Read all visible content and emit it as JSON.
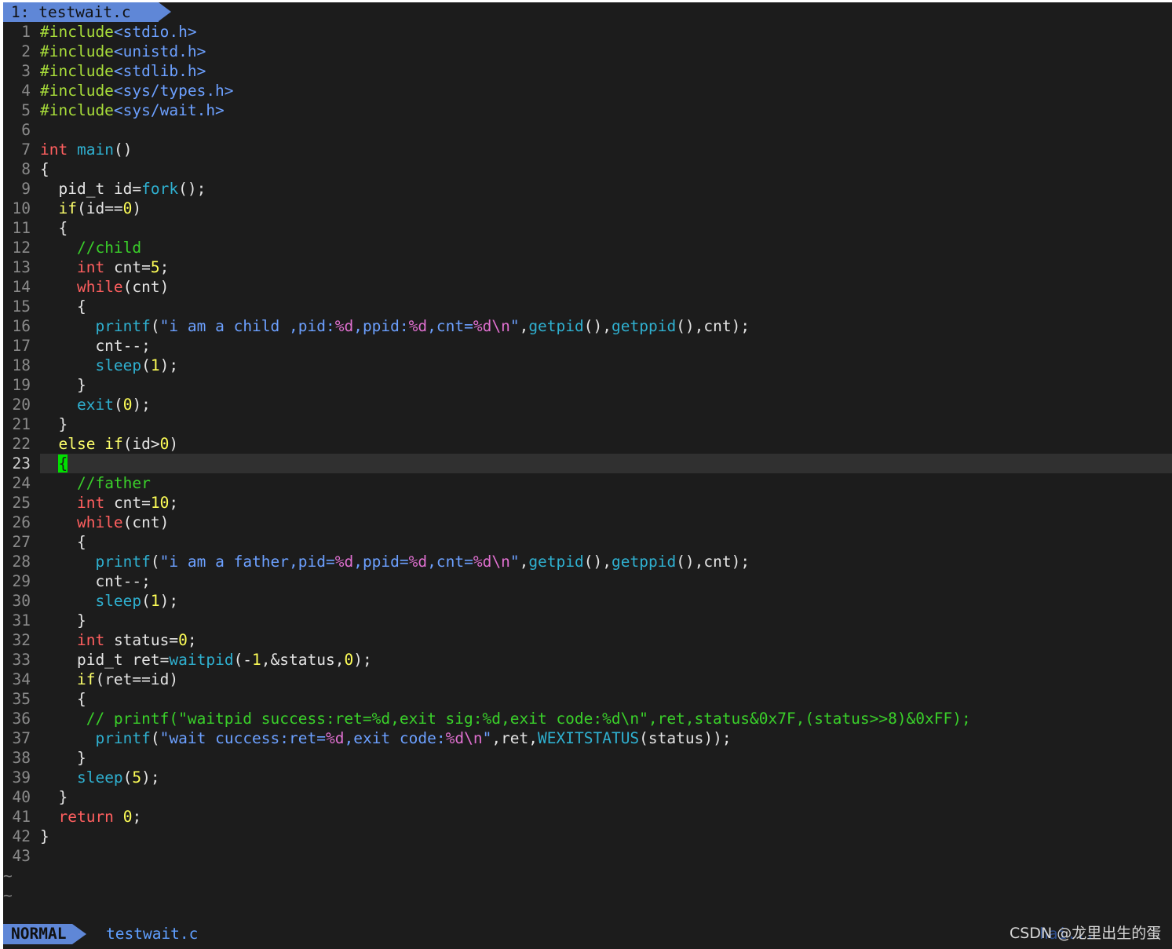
{
  "tabline": {
    "active_tab": "1: testwait.c"
  },
  "editor": {
    "lines": [
      {
        "n": "1",
        "segs": [
          {
            "t": "#include",
            "c": "pp"
          },
          {
            "t": "<stdio.h>",
            "c": "str"
          }
        ]
      },
      {
        "n": "2",
        "segs": [
          {
            "t": "#include",
            "c": "pp"
          },
          {
            "t": "<unistd.h>",
            "c": "str"
          }
        ]
      },
      {
        "n": "3",
        "segs": [
          {
            "t": "#include",
            "c": "pp"
          },
          {
            "t": "<stdlib.h>",
            "c": "str"
          }
        ]
      },
      {
        "n": "4",
        "segs": [
          {
            "t": "#include",
            "c": "pp"
          },
          {
            "t": "<sys/types.h>",
            "c": "str"
          }
        ]
      },
      {
        "n": "5",
        "segs": [
          {
            "t": "#include",
            "c": "pp"
          },
          {
            "t": "<sys/wait.h>",
            "c": "str"
          }
        ]
      },
      {
        "n": "6",
        "segs": []
      },
      {
        "n": "7",
        "segs": [
          {
            "t": "int",
            "c": "kw"
          },
          {
            "t": " "
          },
          {
            "t": "main",
            "c": "fn"
          },
          {
            "t": "()"
          }
        ]
      },
      {
        "n": "8",
        "segs": [
          {
            "t": "{"
          }
        ]
      },
      {
        "n": "9",
        "segs": [
          {
            "t": "  pid_t id="
          },
          {
            "t": "fork",
            "c": "fn"
          },
          {
            "t": "();"
          }
        ]
      },
      {
        "n": "10",
        "segs": [
          {
            "t": "  "
          },
          {
            "t": "if",
            "c": "kw2"
          },
          {
            "t": "(id=="
          },
          {
            "t": "0",
            "c": "num"
          },
          {
            "t": ")"
          }
        ]
      },
      {
        "n": "11",
        "segs": [
          {
            "t": "  {"
          }
        ]
      },
      {
        "n": "12",
        "segs": [
          {
            "t": "    "
          },
          {
            "t": "//child",
            "c": "cmt"
          }
        ]
      },
      {
        "n": "13",
        "segs": [
          {
            "t": "    "
          },
          {
            "t": "int",
            "c": "kw"
          },
          {
            "t": " cnt="
          },
          {
            "t": "5",
            "c": "num"
          },
          {
            "t": ";"
          }
        ]
      },
      {
        "n": "14",
        "segs": [
          {
            "t": "    "
          },
          {
            "t": "while",
            "c": "kw"
          },
          {
            "t": "(cnt)"
          }
        ]
      },
      {
        "n": "15",
        "segs": [
          {
            "t": "    {"
          }
        ]
      },
      {
        "n": "16",
        "segs": [
          {
            "t": "      "
          },
          {
            "t": "printf",
            "c": "fn"
          },
          {
            "t": "("
          },
          {
            "t": "\"i am a child ,pid:",
            "c": "str"
          },
          {
            "t": "%d",
            "c": "fmt"
          },
          {
            "t": ",ppid:",
            "c": "str"
          },
          {
            "t": "%d",
            "c": "fmt"
          },
          {
            "t": ",cnt=",
            "c": "str"
          },
          {
            "t": "%d\\n",
            "c": "fmt"
          },
          {
            "t": "\"",
            "c": "str"
          },
          {
            "t": ","
          },
          {
            "t": "getpid",
            "c": "fn"
          },
          {
            "t": "(),"
          },
          {
            "t": "getppid",
            "c": "fn"
          },
          {
            "t": "(),cnt);"
          }
        ]
      },
      {
        "n": "17",
        "segs": [
          {
            "t": "      cnt--;"
          }
        ]
      },
      {
        "n": "18",
        "segs": [
          {
            "t": "      "
          },
          {
            "t": "sleep",
            "c": "fn"
          },
          {
            "t": "("
          },
          {
            "t": "1",
            "c": "num"
          },
          {
            "t": ");"
          }
        ]
      },
      {
        "n": "19",
        "segs": [
          {
            "t": "    }"
          }
        ]
      },
      {
        "n": "20",
        "segs": [
          {
            "t": "    "
          },
          {
            "t": "exit",
            "c": "fn"
          },
          {
            "t": "("
          },
          {
            "t": "0",
            "c": "num"
          },
          {
            "t": ");"
          }
        ]
      },
      {
        "n": "21",
        "segs": [
          {
            "t": "  }"
          }
        ]
      },
      {
        "n": "22",
        "segs": [
          {
            "t": "  "
          },
          {
            "t": "else",
            "c": "kw2"
          },
          {
            "t": " "
          },
          {
            "t": "if",
            "c": "kw2"
          },
          {
            "t": "(id>"
          },
          {
            "t": "0",
            "c": "num"
          },
          {
            "t": ")"
          }
        ]
      },
      {
        "n": "23",
        "cursorline": true,
        "segs": [
          {
            "t": "  "
          },
          {
            "t": "{",
            "c": "cursor"
          }
        ]
      },
      {
        "n": "24",
        "segs": [
          {
            "t": "    "
          },
          {
            "t": "//father",
            "c": "cmt"
          }
        ]
      },
      {
        "n": "25",
        "segs": [
          {
            "t": "    "
          },
          {
            "t": "int",
            "c": "kw"
          },
          {
            "t": " cnt="
          },
          {
            "t": "10",
            "c": "num"
          },
          {
            "t": ";"
          }
        ]
      },
      {
        "n": "26",
        "segs": [
          {
            "t": "    "
          },
          {
            "t": "while",
            "c": "kw"
          },
          {
            "t": "(cnt)"
          }
        ]
      },
      {
        "n": "27",
        "segs": [
          {
            "t": "    {"
          }
        ]
      },
      {
        "n": "28",
        "segs": [
          {
            "t": "      "
          },
          {
            "t": "printf",
            "c": "fn"
          },
          {
            "t": "("
          },
          {
            "t": "\"i am a father,pid=",
            "c": "str"
          },
          {
            "t": "%d",
            "c": "fmt"
          },
          {
            "t": ",ppid=",
            "c": "str"
          },
          {
            "t": "%d",
            "c": "fmt"
          },
          {
            "t": ",cnt=",
            "c": "str"
          },
          {
            "t": "%d\\n",
            "c": "fmt"
          },
          {
            "t": "\"",
            "c": "str"
          },
          {
            "t": ","
          },
          {
            "t": "getpid",
            "c": "fn"
          },
          {
            "t": "(),"
          },
          {
            "t": "getppid",
            "c": "fn"
          },
          {
            "t": "(),cnt);"
          }
        ]
      },
      {
        "n": "29",
        "segs": [
          {
            "t": "      cnt--;"
          }
        ]
      },
      {
        "n": "30",
        "segs": [
          {
            "t": "      "
          },
          {
            "t": "sleep",
            "c": "fn"
          },
          {
            "t": "("
          },
          {
            "t": "1",
            "c": "num"
          },
          {
            "t": ");"
          }
        ]
      },
      {
        "n": "31",
        "segs": [
          {
            "t": "    }"
          }
        ]
      },
      {
        "n": "32",
        "segs": [
          {
            "t": "    "
          },
          {
            "t": "int",
            "c": "kw"
          },
          {
            "t": " status="
          },
          {
            "t": "0",
            "c": "num"
          },
          {
            "t": ";"
          }
        ]
      },
      {
        "n": "33",
        "segs": [
          {
            "t": "    pid_t ret="
          },
          {
            "t": "waitpid",
            "c": "fn"
          },
          {
            "t": "(-"
          },
          {
            "t": "1",
            "c": "num"
          },
          {
            "t": ",&status,"
          },
          {
            "t": "0",
            "c": "num"
          },
          {
            "t": ");"
          }
        ]
      },
      {
        "n": "34",
        "segs": [
          {
            "t": "    "
          },
          {
            "t": "if",
            "c": "kw2"
          },
          {
            "t": "(ret==id)"
          }
        ]
      },
      {
        "n": "35",
        "segs": [
          {
            "t": "    {"
          }
        ]
      },
      {
        "n": "36",
        "segs": [
          {
            "t": "     // printf(\"waitpid success:ret=%d,exit sig:%d,exit code:%d\\n\",ret,status&0x7F,(status>>8)&0xFF);",
            "c": "cmt"
          }
        ]
      },
      {
        "n": "37",
        "segs": [
          {
            "t": "      "
          },
          {
            "t": "printf",
            "c": "fn"
          },
          {
            "t": "("
          },
          {
            "t": "\"wait cuccess:ret=",
            "c": "str"
          },
          {
            "t": "%d",
            "c": "fmt"
          },
          {
            "t": ",exit code:",
            "c": "str"
          },
          {
            "t": "%d\\n",
            "c": "fmt"
          },
          {
            "t": "\"",
            "c": "str"
          },
          {
            "t": ",ret,"
          },
          {
            "t": "WEXITSTATUS",
            "c": "fn"
          },
          {
            "t": "(status));"
          }
        ]
      },
      {
        "n": "38",
        "segs": [
          {
            "t": "    }"
          }
        ]
      },
      {
        "n": "39",
        "segs": [
          {
            "t": "    "
          },
          {
            "t": "sleep",
            "c": "fn"
          },
          {
            "t": "("
          },
          {
            "t": "5",
            "c": "num"
          },
          {
            "t": ");"
          }
        ]
      },
      {
        "n": "40",
        "segs": [
          {
            "t": "  }"
          }
        ]
      },
      {
        "n": "41",
        "segs": [
          {
            "t": "  "
          },
          {
            "t": "return",
            "c": "kw"
          },
          {
            "t": " "
          },
          {
            "t": "0",
            "c": "num"
          },
          {
            "t": ";"
          }
        ]
      },
      {
        "n": "42",
        "segs": [
          {
            "t": "}"
          }
        ]
      },
      {
        "n": "43",
        "segs": []
      }
    ],
    "tildes": [
      "~",
      "~"
    ]
  },
  "statusline": {
    "mode": "NORMAL",
    "file": "testwait.c",
    "right": "hai..."
  },
  "watermark": "CSDN @龙里出生的蛋",
  "colors": {
    "background": "#1c1c1c",
    "accent": "#5f87d7",
    "preproc": "#a8dd3a",
    "string": "#6ca0ff",
    "format": "#e070d0",
    "keyword": "#ff5f5f",
    "conditional": "#fdff6b",
    "function": "#2fb0d0",
    "number": "#ffff57",
    "comment": "#3ad02a",
    "cursor": "#00e000"
  }
}
